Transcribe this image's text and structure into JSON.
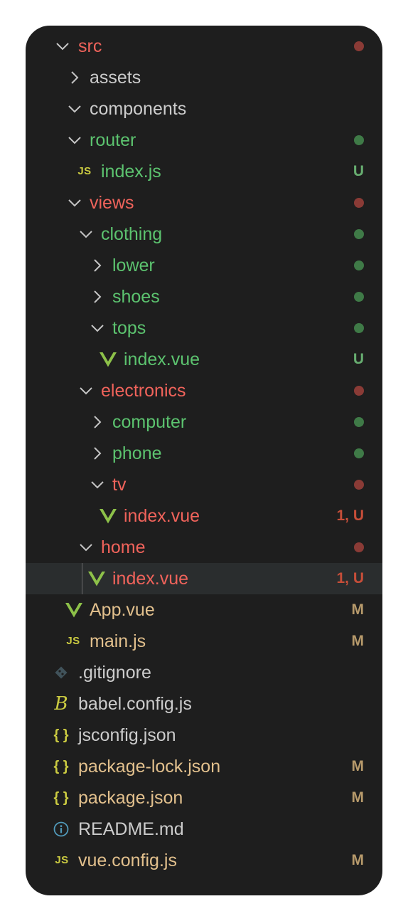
{
  "colors": {
    "panel_bg": "#1e1e1e",
    "deleted_red": "#f0635b",
    "untracked_green": "#5cc36f",
    "modified_yellow": "#e2c08d",
    "plain": "#cccccc",
    "selected_bg": "#2a2d2e"
  },
  "explorer": {
    "src": {
      "label": "src"
    },
    "assets": {
      "label": "assets"
    },
    "components": {
      "label": "components"
    },
    "router": {
      "label": "router"
    },
    "router_index": {
      "label": "index.js",
      "badge": "U",
      "icon": "JS"
    },
    "views": {
      "label": "views"
    },
    "clothing": {
      "label": "clothing"
    },
    "lower": {
      "label": "lower"
    },
    "shoes": {
      "label": "shoes"
    },
    "tops": {
      "label": "tops"
    },
    "tops_index": {
      "label": "index.vue",
      "badge": "U"
    },
    "electronics": {
      "label": "electronics"
    },
    "computer": {
      "label": "computer"
    },
    "phone": {
      "label": "phone"
    },
    "tv": {
      "label": "tv"
    },
    "tv_index": {
      "label": "index.vue",
      "badge": "1, U"
    },
    "home": {
      "label": "home"
    },
    "home_index": {
      "label": "index.vue",
      "badge": "1, U"
    },
    "app_vue": {
      "label": "App.vue",
      "badge": "M"
    },
    "main_js": {
      "label": "main.js",
      "badge": "M",
      "icon": "JS"
    },
    "gitignore": {
      "label": ".gitignore"
    },
    "babel_config": {
      "label": "babel.config.js",
      "icon": "B"
    },
    "jsconfig": {
      "label": "jsconfig.json",
      "icon": "{ }"
    },
    "package_lock": {
      "label": "package-lock.json",
      "badge": "M",
      "icon": "{ }"
    },
    "package_json": {
      "label": "package.json",
      "badge": "M",
      "icon": "{ }"
    },
    "readme": {
      "label": "README.md"
    },
    "vue_config": {
      "label": "vue.config.js",
      "badge": "M",
      "icon": "JS"
    }
  }
}
